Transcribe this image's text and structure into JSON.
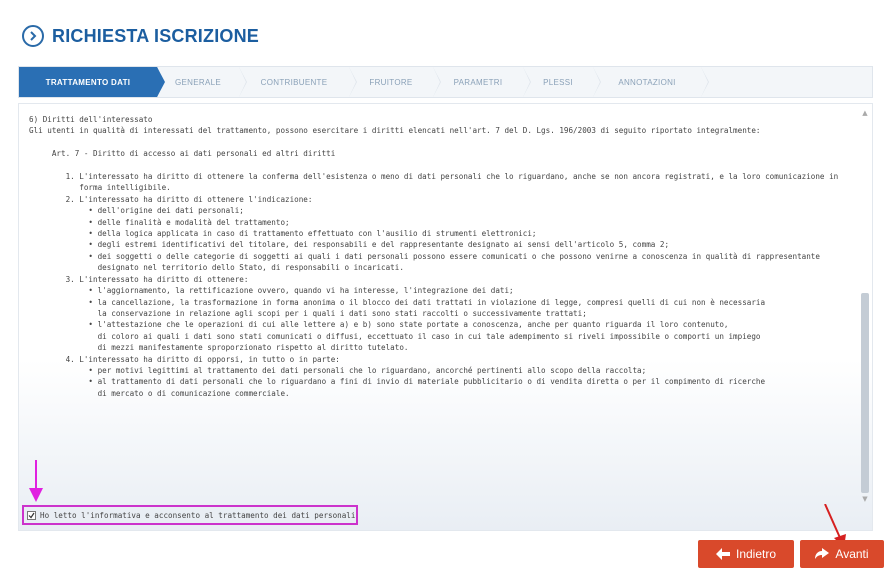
{
  "header": {
    "title": "RICHIESTA ISCRIZIONE",
    "icon": "chevron-right-circle-icon"
  },
  "tabs": [
    {
      "label": "TRATTAMENTO DATI",
      "active": true
    },
    {
      "label": "GENERALE",
      "active": false
    },
    {
      "label": "CONTRIBUENTE",
      "active": false
    },
    {
      "label": "FRUITORE",
      "active": false
    },
    {
      "label": "PARAMETRI",
      "active": false
    },
    {
      "label": "PLESSI",
      "active": false
    },
    {
      "label": "ANNOTAZIONI",
      "active": false
    }
  ],
  "content": {
    "lines": [
      "6) Diritti dell'interessato",
      "Gli utenti in qualità di interessati del trattamento, possono esercitare i diritti elencati nell'art. 7 del D. Lgs. 196/2003 di seguito riportato integralmente:",
      "",
      "     Art. 7 - Diritto di accesso ai dati personali ed altri diritti",
      "",
      "        1. L'interessato ha diritto di ottenere la conferma dell'esistenza o meno di dati personali che lo riguardano, anche se non ancora registrati, e la loro comunicazione in",
      "           forma intelligibile.",
      "        2. L'interessato ha diritto di ottenere l'indicazione:",
      "             • dell'origine dei dati personali;",
      "             • delle finalità e modalità del trattamento;",
      "             • della logica applicata in caso di trattamento effettuato con l'ausilio di strumenti elettronici;",
      "             • degli estremi identificativi del titolare, dei responsabili e del rappresentante designato ai sensi dell'articolo 5, comma 2;",
      "             • dei soggetti o delle categorie di soggetti ai quali i dati personali possono essere comunicati o che possono venirne a conoscenza in qualità di rappresentante",
      "               designato nel territorio dello Stato, di responsabili o incaricati.",
      "        3. L'interessato ha diritto di ottenere:",
      "             • l'aggiornamento, la rettificazione ovvero, quando vi ha interesse, l'integrazione dei dati;",
      "             • la cancellazione, la trasformazione in forma anonima o il blocco dei dati trattati in violazione di legge, compresi quelli di cui non è necessaria",
      "               la conservazione in relazione agli scopi per i quali i dati sono stati raccolti o successivamente trattati;",
      "             • l'attestazione che le operazioni di cui alle lettere a) e b) sono state portate a conoscenza, anche per quanto riguarda il loro contenuto,",
      "               di coloro ai quali i dati sono stati comunicati o diffusi, eccettuato il caso in cui tale adempimento si riveli impossibile o comporti un impiego",
      "               di mezzi manifestamente sproporzionato rispetto al diritto tutelato.",
      "        4. L'interessato ha diritto di opporsi, in tutto o in parte:",
      "             • per motivi legittimi al trattamento dei dati personali che lo riguardano, ancorché pertinenti allo scopo della raccolta;",
      "             • al trattamento di dati personali che lo riguardano a fini di invio di materiale pubblicitario o di vendita diretta o per il compimento di ricerche",
      "               di mercato o di comunicazione commerciale."
    ]
  },
  "consent": {
    "label": "Ho letto l'informativa e acconsento al trattamento dei dati personali",
    "checked": true
  },
  "buttons": {
    "back": "Indietro",
    "next": "Avanti"
  },
  "colors": {
    "accent": "#2a6fb4",
    "button": "#d9492b",
    "highlight": "#cc33cc",
    "arrow": "#d62020"
  }
}
